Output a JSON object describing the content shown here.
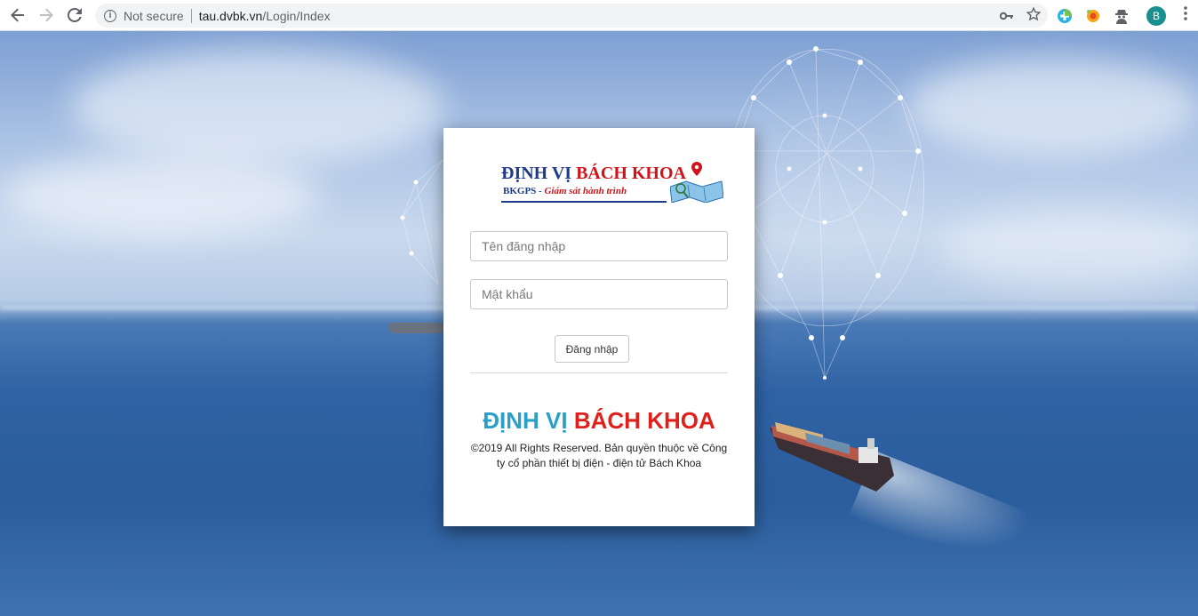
{
  "browser": {
    "security_label": "Not secure",
    "url_host": "tau.dvbk.vn",
    "url_path": "/Login/Index",
    "profile_initial": "B"
  },
  "login": {
    "logo": {
      "title_part1": "ĐỊNH VỊ ",
      "title_part2": "BÁCH KHOA",
      "subtitle_part1": "BKGPS - ",
      "subtitle_part2": "Giám sát hành trình"
    },
    "username_placeholder": "Tên đăng nhập",
    "password_placeholder": "Mật khẩu",
    "submit_label": "Đăng nhập",
    "brand_part1": "ĐỊNH VỊ ",
    "brand_part2": "BÁCH KHOA",
    "copyright": "©2019 All Rights Reserved. Bản quyền thuộc về Công ty cổ phần thiết bị điện - điện tử Bách Khoa"
  },
  "colors": {
    "brand_blue": "#2aa0c8",
    "brand_red": "#e0201b",
    "logo_navy": "#1e3a8a"
  },
  "icons": [
    "back-arrow-icon",
    "forward-arrow-icon",
    "reload-icon",
    "info-icon",
    "key-icon",
    "star-icon",
    "extension-plus-icon",
    "extension-flower-icon",
    "extension-spy-icon",
    "more-menu-icon"
  ]
}
